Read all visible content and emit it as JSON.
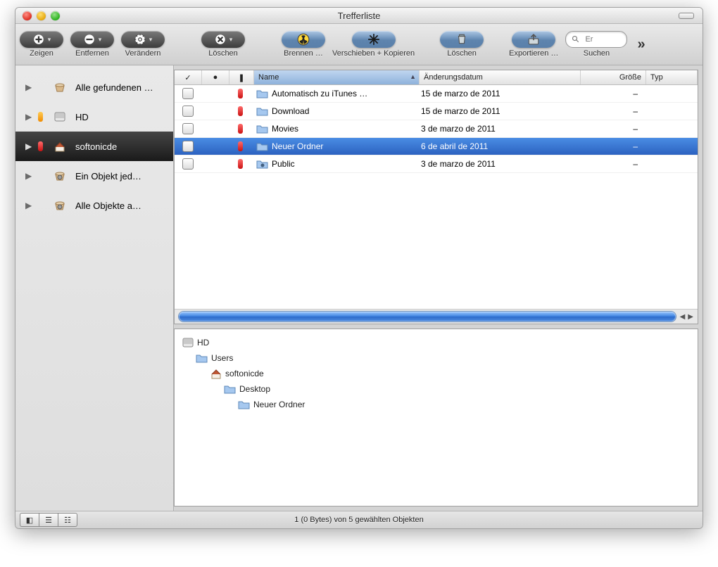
{
  "window": {
    "title": "Trefferliste"
  },
  "toolbar": {
    "items": [
      {
        "id": "zeigen",
        "label": "Zeigen",
        "style": "dark",
        "icon": "plus"
      },
      {
        "id": "entfernen",
        "label": "Entfernen",
        "style": "dark",
        "icon": "minus"
      },
      {
        "id": "veraendern",
        "label": "Verändern",
        "style": "dark",
        "icon": "gear"
      },
      {
        "id": "loeschen",
        "label": "Löschen",
        "style": "dark",
        "icon": "x"
      },
      {
        "id": "brennen",
        "label": "Brennen …",
        "style": "blue",
        "icon": "radioactive"
      },
      {
        "id": "verschieben",
        "label": "Verschieben + Kopieren",
        "style": "blue",
        "icon": "burst"
      },
      {
        "id": "loeschen2",
        "label": "Löschen",
        "style": "blue",
        "icon": "trash"
      },
      {
        "id": "exportieren",
        "label": "Exportieren …",
        "style": "blue",
        "icon": "export"
      }
    ],
    "search_placeholder": "Er",
    "search_label": "Suchen"
  },
  "sidebar": [
    {
      "icon": "basket",
      "label": "Alle gefundenen …",
      "pill": ""
    },
    {
      "icon": "hd",
      "label": "HD",
      "pill": "orange"
    },
    {
      "icon": "home",
      "label": "softonicde",
      "pill": "red",
      "selected": true
    },
    {
      "icon": "basket-gear",
      "label": "Ein Objekt jed…",
      "pill": ""
    },
    {
      "icon": "basket-gear",
      "label": "Alle Objekte a…",
      "pill": ""
    }
  ],
  "columns": {
    "c1": "✓",
    "c2": "●",
    "c3": "❚",
    "name": "Name",
    "date": "Änderungsdatum",
    "size": "Größe",
    "type": "Typ"
  },
  "rows": [
    {
      "name": "Automatisch zu iTunes …",
      "date": "15 de marzo de 2011",
      "size": "–",
      "icon": "folder"
    },
    {
      "name": "Download",
      "date": "15 de marzo de 2011",
      "size": "–",
      "icon": "folder"
    },
    {
      "name": "Movies",
      "date": "3 de marzo de 2011",
      "size": "–",
      "icon": "folder"
    },
    {
      "name": "Neuer Ordner",
      "date": "6 de abril de 2011",
      "size": "–",
      "icon": "folder",
      "selected": true
    },
    {
      "name": "Public",
      "date": "3 de marzo de 2011",
      "size": "–",
      "icon": "folder-share"
    }
  ],
  "tree": [
    {
      "indent": 0,
      "icon": "hd",
      "label": "HD"
    },
    {
      "indent": 1,
      "icon": "folder",
      "label": "Users"
    },
    {
      "indent": 2,
      "icon": "home",
      "label": "softonicde"
    },
    {
      "indent": 3,
      "icon": "folder",
      "label": "Desktop"
    },
    {
      "indent": 4,
      "icon": "folder",
      "label": "Neuer Ordner"
    }
  ],
  "status": "1 (0 Bytes) von 5 gewählten Objekten"
}
